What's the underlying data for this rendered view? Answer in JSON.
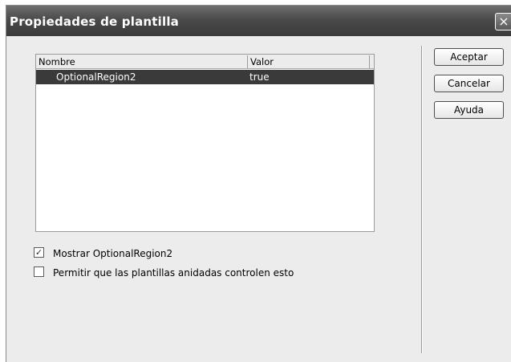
{
  "dialog": {
    "title": "Propiedades de plantilla",
    "close_icon": "×"
  },
  "table": {
    "headers": {
      "name": "Nombre",
      "value": "Valor"
    },
    "rows": [
      {
        "name": "OptionalRegion2",
        "value": "true",
        "selected": true
      }
    ]
  },
  "options": {
    "show_label": "Mostrar OptionalRegion2",
    "show_checked": true,
    "check_mark": "✓",
    "nested_label": "Permitir que las plantillas anidadas controlen esto",
    "nested_checked": false
  },
  "buttons": {
    "accept": "Aceptar",
    "cancel": "Cancelar",
    "help": "Ayuda"
  },
  "colors": {
    "title_bar": "#4a4a4a",
    "selection": "#3a3a3a",
    "dialog_bg": "#ececec"
  }
}
